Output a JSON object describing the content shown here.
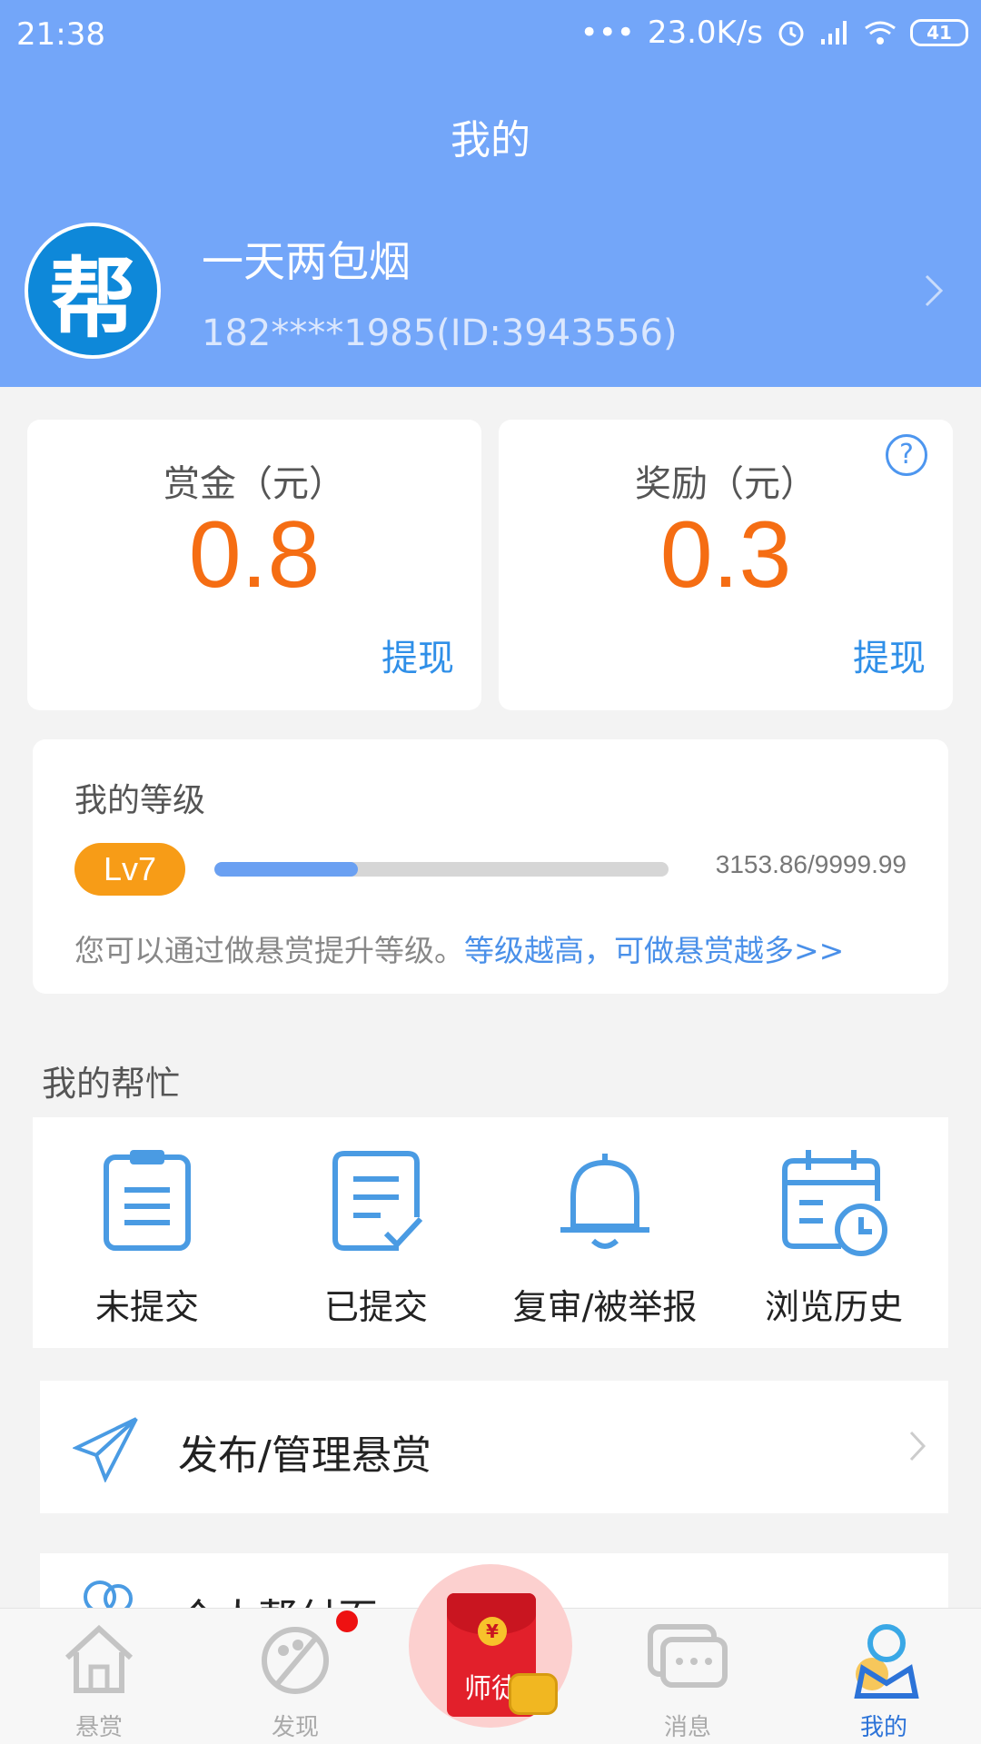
{
  "status_bar": {
    "time": "21:38",
    "speed": "23.0K/s",
    "battery": "41"
  },
  "header": {
    "title": "我的",
    "username": "一天两包烟",
    "user_id": "182****1985(ID:3943556)",
    "avatar_text": "帮"
  },
  "bounty_card": {
    "label": "赏金（元）",
    "value": "0.8",
    "withdraw": "提现"
  },
  "reward_card": {
    "label": "奖励（元）",
    "value": "0.3",
    "withdraw": "提现",
    "help_glyph": "?"
  },
  "level": {
    "title": "我的等级",
    "badge": "Lv7",
    "progress_fraction": 0.3154,
    "score": "3153.86/9999.99",
    "tip": "您可以通过做悬赏提升等级。",
    "tip_link": "等级越高，可做悬赏越多>>"
  },
  "my_help": {
    "title": "我的帮忙",
    "items": [
      {
        "label": "未提交",
        "icon": "clipboard-icon"
      },
      {
        "label": "已提交",
        "icon": "document-check-icon"
      },
      {
        "label": "复审/被举报",
        "icon": "bell-icon"
      },
      {
        "label": "浏览历史",
        "icon": "calendar-clock-icon"
      }
    ]
  },
  "list": {
    "publish": {
      "label": "发布/管理悬赏",
      "icon": "paper-plane-icon"
    },
    "partial": {
      "label": "个人帮付页",
      "icon": "people-icon"
    }
  },
  "tabbar": {
    "items": [
      {
        "label": "悬赏",
        "icon": "home-icon"
      },
      {
        "label": "发现",
        "icon": "palette-icon"
      },
      {
        "label": "师徒",
        "icon": "red-envelope-icon"
      },
      {
        "label": "消息",
        "icon": "chat-icon"
      },
      {
        "label": "我的",
        "icon": "profile-icon"
      }
    ],
    "active": "我的"
  },
  "colors": {
    "header_blue": "#73a6f9",
    "amount_orange": "#f56d13",
    "link_blue": "#2f8fe8",
    "level_badge": "#f79c17",
    "tab_active": "#2c73d8"
  }
}
